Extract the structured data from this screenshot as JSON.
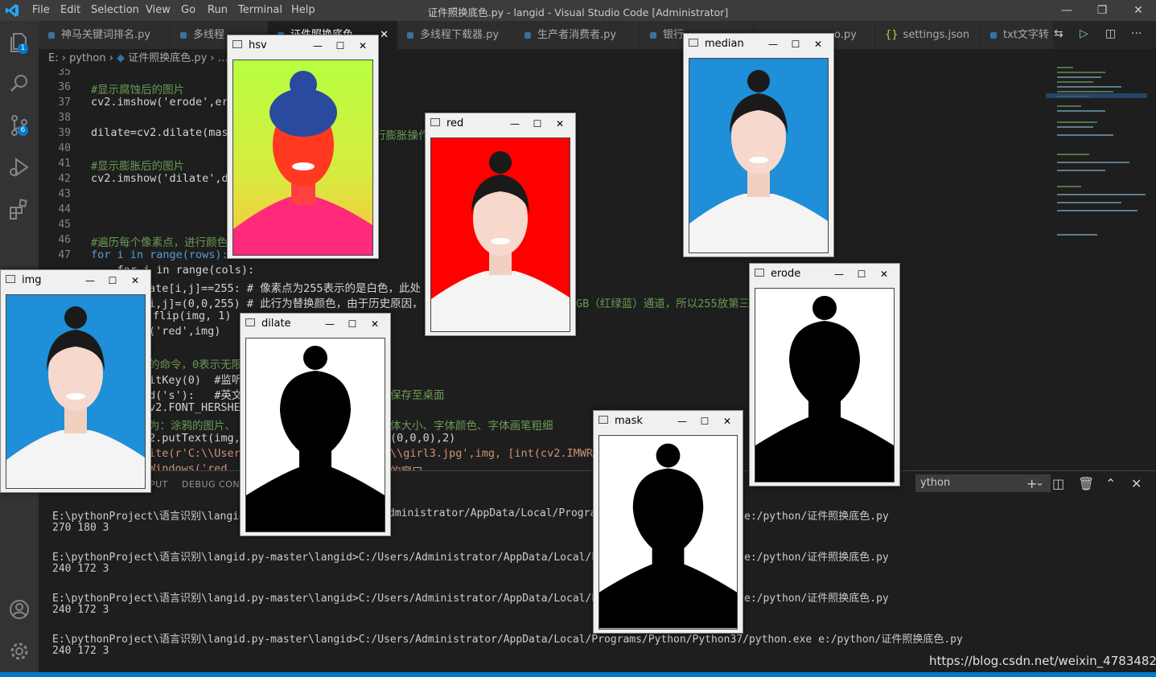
{
  "titlebar": {
    "menu": [
      "File",
      "Edit",
      "Selection",
      "View",
      "Go",
      "Run",
      "Terminal",
      "Help"
    ],
    "title": "证件照换底色.py - langid - Visual Studio Code [Administrator]",
    "minimize": "—",
    "restore": "❐",
    "close": "✕"
  },
  "activity": {
    "explorer_badge": "1",
    "scm_badge": "6"
  },
  "tabs": [
    "神马关键词排名.py",
    "多线程",
    "证件照换底色",
    "多线程下载器.py",
    "生产者消费者.py",
    "银行",
    "o.py",
    "settings.json",
    "txt文字转"
  ],
  "settings_json_icon": "{}",
  "breadcrumb": {
    "drive": "E:",
    "folder": "python",
    "file": "证件照换底色.py",
    "more": "…"
  },
  "code": [
    {
      "n": "35",
      "t": ""
    },
    {
      "n": "36",
      "t": "#显示腐蚀后的图片"
    },
    {
      "n": "37",
      "t": "cv2.imshow('erode',ero"
    },
    {
      "n": "38",
      "t": ""
    },
    {
      "n": "39",
      "t": "dilate=cv2.dilate(mask",
      "tail": "行膨胀操作"
    },
    {
      "n": "40",
      "t": ""
    },
    {
      "n": "41",
      "t": "#显示膨胀后的图片"
    },
    {
      "n": "42",
      "t": "cv2.imshow('dilate',di"
    },
    {
      "n": "43",
      "t": ""
    },
    {
      "n": "44",
      "t": ""
    },
    {
      "n": "45",
      "t": ""
    },
    {
      "n": "46",
      "t": "#遍历每个像素点，进行颜色"
    },
    {
      "n": "47",
      "t": "for i in range(rows):"
    }
  ],
  "code_rest": [
    "    for j in range(cols):",
    "ate[i,j]==255: # 像素点为255表示的是白色，此处",
    "i,j]=(0,0,255) # 此行为替换颜色，由于历史原因，",
    "flip(img, 1)",
    "('red',img)",
    "",
    "的命令，0表示无限",
    "itKey(0)  #监听",
    "d('s'):   #英文",
    "v2.FONT_HERSHE",
    "为：涂鸦的图片、",
    "2.putText(img,",
    "ite(r'C:\\\\User",
    "Windows('red"
  ],
  "code_right": [
    "GB（红绿蓝）通道，所以255放第三",
    "保存至桌面",
    "体大小、字体颜色、字体画笔粗细",
    "(0,0,0),2)",
    "\\\\girl3.jpg',img, [int(cv2.IMWRI",
    "的窗口"
  ],
  "panel": {
    "tabs": [
      "PUT",
      "DEBUG CONSO"
    ],
    "terminal_select": "ython",
    "terminal_lines": [
      "E:\\pythonProject\\语言识别\\langid.",
      "270 180 3",
      "",
      "E:\\pythonProject\\语言识别\\langid.py-master\\langid>C:/Users/Administrator/AppData/Local/Programs/",
      "240 172 3",
      "",
      "E:\\pythonProject\\语言识别\\langid.py-master\\langid>C:/Users/Administrator/AppData/Local/Programs/",
      "240 172 3",
      "",
      "E:\\pythonProject\\语言识别\\langid.py-master\\langid>C:/Users/Administrator/AppData/Local/Programs/Python/Python37/python.exe e:/python/证件照换底色.py",
      "240 172 3"
    ],
    "mid_cmd": "dministrator/AppData/Local/Programs/",
    "cmd_tail": "e:/python/证件照换底色.py"
  },
  "cv_windows": {
    "hsv": "hsv",
    "red": "red",
    "median": "median",
    "img": "img",
    "dilate": "dilate",
    "erode": "erode",
    "mask": "mask"
  },
  "cv_buttons": {
    "min": "—",
    "max": "☐",
    "close": "✕"
  },
  "watermark": "https://blog.csdn.net/weixin_47834823",
  "colors": {
    "accent": "#007acc",
    "red_bg": "#ff0000",
    "blue_bg": "#1e8fd8",
    "hsv_bg": "#b8ff40"
  }
}
